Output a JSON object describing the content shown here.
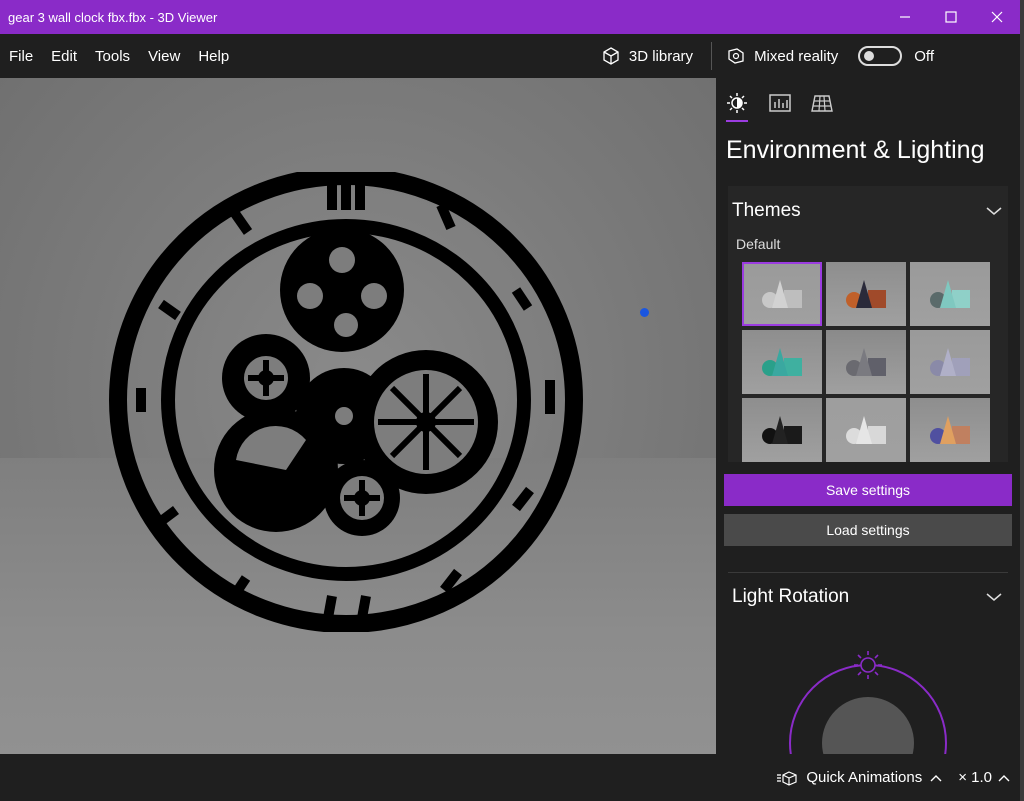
{
  "window": {
    "title": "gear 3 wall clock fbx.fbx - 3D Viewer",
    "accent": "#8a2bc8"
  },
  "menu": {
    "items": [
      "File",
      "Edit",
      "Tools",
      "View",
      "Help"
    ],
    "library_label": "3D library",
    "mixed_reality_label": "Mixed reality",
    "mixed_reality_state": "Off"
  },
  "panel": {
    "tabs": [
      "sun-settings-icon",
      "stats-icon",
      "grid-icon"
    ],
    "title": "Environment & Lighting",
    "themes": {
      "heading": "Themes",
      "selected": "Default",
      "tiles": [
        {
          "bg": "#9a9a9a",
          "shapes": [
            "#c8c8c8",
            "#d2d2d2",
            "#bebebe"
          ]
        },
        {
          "bg": "#8e8e8e",
          "shapes": [
            "#c0602a",
            "#2a2a3a",
            "#a04a2a"
          ]
        },
        {
          "bg": "#9a9a9a",
          "shapes": [
            "#5a6a6a",
            "#7fc8c0",
            "#8fd0c8"
          ]
        },
        {
          "bg": "#8e8e8e",
          "shapes": [
            "#2aa08a",
            "#3aa8a0",
            "#3fb0a0"
          ]
        },
        {
          "bg": "#8a8a8a",
          "shapes": [
            "#6a6a70",
            "#7a7a80",
            "#60606a"
          ]
        },
        {
          "bg": "#9a9a9a",
          "shapes": [
            "#8a8aa8",
            "#b0b0c8",
            "#a0a0ba"
          ]
        },
        {
          "bg": "#8e8e8e",
          "shapes": [
            "#111111",
            "#222222",
            "#1a1a1a"
          ]
        },
        {
          "bg": "#9e9e9e",
          "shapes": [
            "#dcdcdc",
            "#e6e6e6",
            "#d8d8d8"
          ]
        },
        {
          "bg": "#8e8e8e",
          "shapes": [
            "#5050a0",
            "#e0a060",
            "#c08060"
          ]
        }
      ]
    },
    "save_label": "Save settings",
    "load_label": "Load settings",
    "light_rotation": {
      "heading": "Light Rotation"
    }
  },
  "bottom": {
    "animations_label": "Quick Animations",
    "speed_label": "× 1.0"
  }
}
